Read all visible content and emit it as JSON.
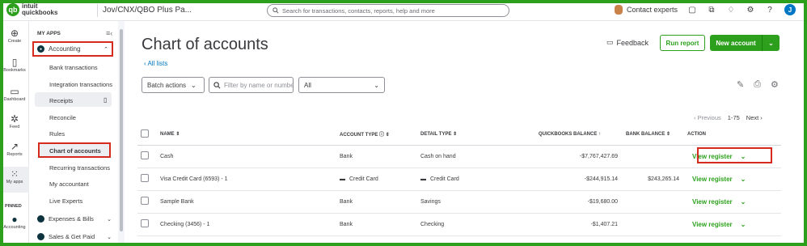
{
  "topbar": {
    "logo_text_1": "intuit",
    "logo_text_2": "quickbooks",
    "company": "Jov/CNX/QBO Plus Pa...",
    "search_placeholder": "Search for transactions, contacts, reports, help and more",
    "contact_experts": "Contact experts",
    "user_initial": "J"
  },
  "rail": [
    {
      "label": "Create",
      "icon": "plus-circle-icon",
      "glyph": "⊕"
    },
    {
      "label": "Bookmarks",
      "icon": "bookmark-icon",
      "glyph": "▯"
    },
    {
      "label": "Dashboard",
      "icon": "dashboard-icon",
      "glyph": "▭"
    },
    {
      "label": "Feed",
      "icon": "feed-icon",
      "glyph": "✲"
    },
    {
      "label": "Reports",
      "icon": "reports-icon",
      "glyph": "↗"
    },
    {
      "label": "My apps",
      "icon": "apps-grid-icon",
      "glyph": "⁙"
    },
    {
      "label": "PINNED",
      "icon": "",
      "glyph": ""
    },
    {
      "label": "Accounting",
      "icon": "accounting-icon",
      "glyph": "●"
    }
  ],
  "sidebar": {
    "section_title": "MY APPS",
    "accounting_label": "Accounting",
    "items": [
      "Bank transactions",
      "Integration transactions",
      "Receipts",
      "Reconcile",
      "Rules",
      "Chart of accounts",
      "Recurring transactions",
      "My accountant",
      "Live Experts"
    ],
    "groups": [
      "Expenses & Bills",
      "Sales & Get Paid"
    ]
  },
  "main": {
    "title": "Chart of accounts",
    "back_link": "All lists",
    "feedback": "Feedback",
    "run_report": "Run report",
    "new_account": "New account",
    "batch_actions": "Batch actions",
    "filter_placeholder": "Filter by name or number",
    "type_filter": "All",
    "pager": {
      "previous": "Previous",
      "range": "1-75",
      "next": "Next"
    }
  },
  "table": {
    "headers": [
      "NAME",
      "ACCOUNT TYPE",
      "DETAIL TYPE",
      "QUICKBOOKS BALANCE",
      "BANK BALANCE",
      "ACTION"
    ],
    "rows": [
      {
        "name": "Cash",
        "type": "Bank",
        "detail": "Cash on hand",
        "qb_balance": "-$7,767,427.69",
        "bank_balance": "",
        "action": "View register"
      },
      {
        "name": "Visa Credit Card (6593) - 1",
        "type": "Credit Card",
        "detail": "Credit Card",
        "qb_balance": "-$244,915.14",
        "bank_balance": "$243,265.14",
        "action": "View register"
      },
      {
        "name": "Sample Bank",
        "type": "Bank",
        "detail": "Savings",
        "qb_balance": "-$19,680.00",
        "bank_balance": "",
        "action": "View register"
      },
      {
        "name": "Checking (3456) - 1",
        "type": "Bank",
        "detail": "Checking",
        "qb_balance": "-$1,407.21",
        "bank_balance": "",
        "action": "View register"
      }
    ]
  },
  "colors": {
    "brand_green": "#2ca01c",
    "highlight_red": "#d52b1e",
    "link_blue": "#0077c5"
  }
}
